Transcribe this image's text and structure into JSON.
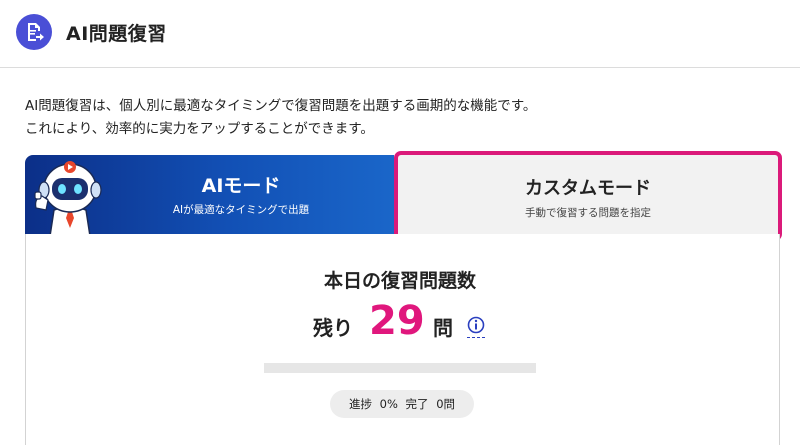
{
  "header": {
    "title": "AI問題復習",
    "icon": "document-arrow-icon",
    "icon_bg": "#4a4fd6"
  },
  "intro": {
    "line1": "AI問題復習は、個人別に最適なタイミングで復習問題を出題する画期的な機能です。",
    "line2": "これにより、効率的に実力をアップすることができます。"
  },
  "tabs": [
    {
      "title": "AIモード",
      "subtitle": "AIが最適なタイミングで出題",
      "selected": false
    },
    {
      "title": "カスタムモード",
      "subtitle": "手動で復習する問題を指定",
      "selected": true
    }
  ],
  "today": {
    "title": "本日の復習問題数",
    "remaining_prefix": "残り",
    "remaining_count": "29",
    "remaining_suffix": "問",
    "progress_fraction": 0,
    "status_progress_label": "進捗",
    "status_progress_value": "0%",
    "status_done_label": "完了",
    "status_done_value": "0問"
  },
  "colors": {
    "accent_pink": "#db1a7a",
    "ai_tab_blue": "#0c2f88",
    "header_icon": "#4a4fd6"
  }
}
